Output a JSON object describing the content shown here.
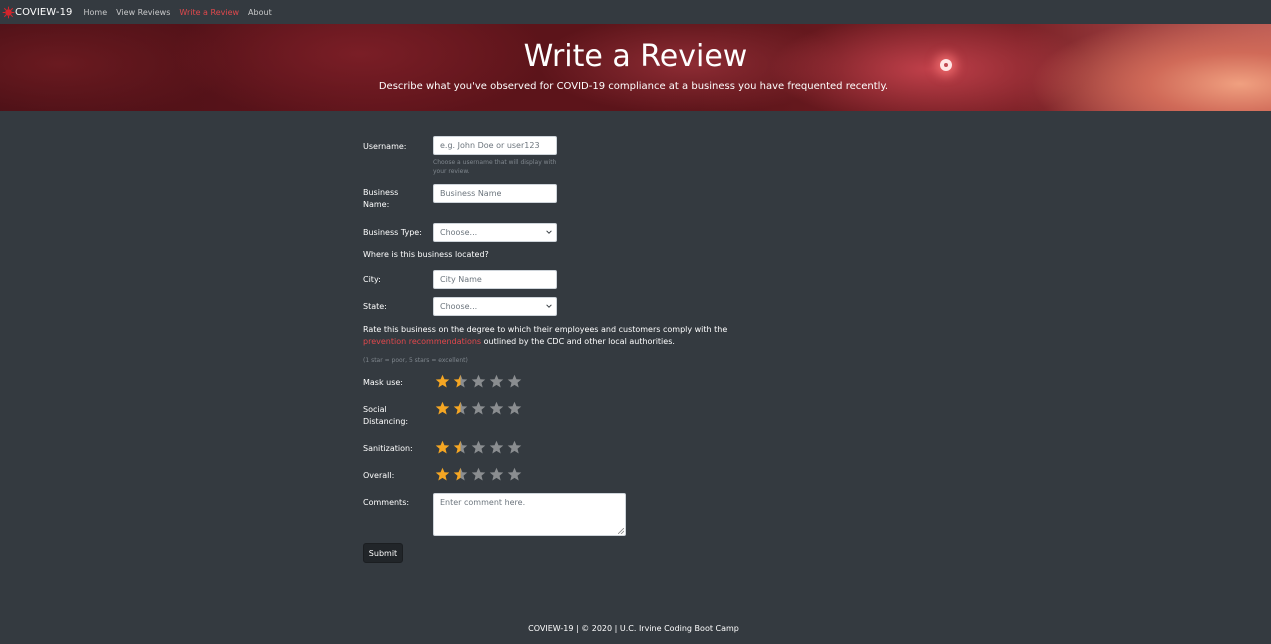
{
  "nav": {
    "brand": "COVIEW-19",
    "links": [
      {
        "label": "Home",
        "active": false
      },
      {
        "label": "View Reviews",
        "active": false
      },
      {
        "label": "Write a Review",
        "active": true
      },
      {
        "label": "About",
        "active": false
      }
    ]
  },
  "hero": {
    "title": "Write a Review",
    "subtitle": "Describe what you've observed for COVID-19 compliance at a business you have frequented recently."
  },
  "form": {
    "username": {
      "label": "Username:",
      "placeholder": "e.g. John Doe or user123",
      "help": "Choose a username that will display with your review."
    },
    "business_name": {
      "label": "Business Name:",
      "placeholder": "Business Name"
    },
    "business_type": {
      "label": "Business Type:",
      "selected": "Choose..."
    },
    "location_heading": "Where is this business located?",
    "city": {
      "label": "City:",
      "placeholder": "City Name"
    },
    "state": {
      "label": "State:",
      "selected": "Choose..."
    },
    "rate_text_before": "Rate this business on the degree to which their employees and customers comply with the ",
    "rate_link": "prevention recommendations",
    "rate_text_after": " outlined by the CDC and other local authorities.",
    "scale_note": "(1 star = poor, 5 stars = excellent)",
    "ratings": [
      {
        "label": "Mask use:",
        "value": 1.5,
        "max": 5
      },
      {
        "label": "Social Distancing:",
        "value": 1.5,
        "max": 5
      },
      {
        "label": "Sanitization:",
        "value": 1.5,
        "max": 5
      },
      {
        "label": "Overall:",
        "value": 1.5,
        "max": 5
      }
    ],
    "comments": {
      "label": "Comments:",
      "placeholder": "Enter comment here."
    },
    "submit_label": "Submit"
  },
  "footer": "COVIEW-19 | © 2020 | U.C. Irvine Coding Boot Camp",
  "colors": {
    "accent": "#e0484c",
    "star_filled": "#f5a623",
    "star_empty": "#8a8d90",
    "background": "#343a40"
  }
}
